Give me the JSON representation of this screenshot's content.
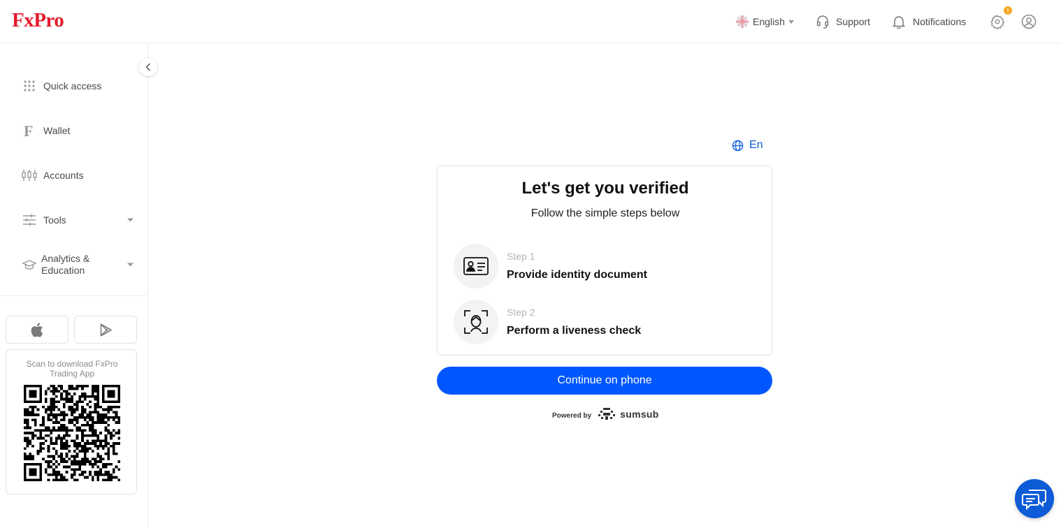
{
  "header": {
    "logo": "FxPro",
    "language": "English",
    "support": "Support",
    "notifications": "Notifications",
    "settings_badge": "!"
  },
  "sidebar": {
    "items": [
      {
        "label": "Quick access",
        "icon": "grid-icon"
      },
      {
        "label": "Wallet",
        "icon": "wallet-f-icon"
      },
      {
        "label": "Accounts",
        "icon": "candlestick-icon"
      },
      {
        "label": "Tools",
        "icon": "sliders-icon"
      },
      {
        "label": "Analytics & Education",
        "icon": "graduation-cap-icon"
      }
    ],
    "qr_caption": "Scan to download FxPro Trading App"
  },
  "verify": {
    "language_link": "En",
    "title": "Let's get you verified",
    "subtitle": "Follow the simple steps below",
    "steps": [
      {
        "label": "Step 1",
        "text": "Provide identity document",
        "icon": "id-card-icon"
      },
      {
        "label": "Step 2",
        "text": "Perform a liveness check",
        "icon": "face-scan-icon"
      }
    ],
    "continue_button": "Continue on phone",
    "powered_by": "Powered by",
    "powered_brand": "sumsub"
  },
  "colors": {
    "brand": "#e21b2c",
    "primary": "#0057ff",
    "link": "#0d5bd7",
    "badge": "#f5a623"
  }
}
